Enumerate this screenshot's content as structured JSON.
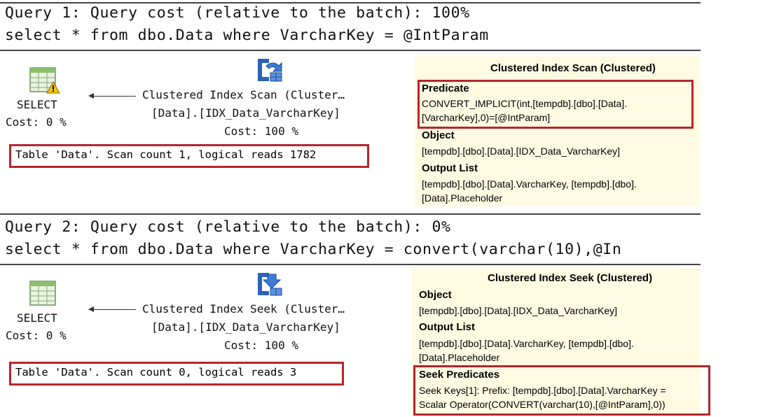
{
  "query1": {
    "header": "Query 1: Query cost (relative to the batch): 100%",
    "sql": "select * from dbo.Data where VarcharKey = @IntParam",
    "select_label": "SELECT",
    "select_cost": "Cost: 0 %",
    "op_name": "Clustered Index Scan (Cluster…",
    "op_object": "[Data].[IDX_Data_VarcharKey]",
    "op_cost": "Cost: 100 %",
    "stats": "Table 'Data'. Scan count 1, logical reads 1782",
    "tooltip": {
      "title": "Clustered Index Scan (Clustered)",
      "predicate_head": "Predicate",
      "predicate_line1": "CONVERT_IMPLICIT(int,[tempdb].[dbo].[Data].",
      "predicate_line2": "[VarcharKey],0)=[@IntParam]",
      "object_head": "Object",
      "object_line": "[tempdb].[dbo].[Data].[IDX_Data_VarcharKey]",
      "output_head": "Output List",
      "output_line1": "[tempdb].[dbo].[Data].VarcharKey, [tempdb].[dbo].",
      "output_line2": "[Data].Placeholder"
    }
  },
  "query2": {
    "header": "Query 2: Query cost (relative to the batch): 0%",
    "sql": "select * from dbo.Data where VarcharKey = convert(varchar(10),@In",
    "select_label": "SELECT",
    "select_cost": "Cost: 0 %",
    "op_name": "Clustered Index Seek (Cluster…",
    "op_object": "[Data].[IDX_Data_VarcharKey]",
    "op_cost": "Cost: 100 %",
    "stats": "Table 'Data'. Scan count 0, logical reads 3",
    "tooltip": {
      "title": "Clustered Index Seek (Clustered)",
      "object_head": "Object",
      "object_line": "[tempdb].[dbo].[Data].[IDX_Data_VarcharKey]",
      "output_head": "Output List",
      "output_line1": "[tempdb].[dbo].[Data].VarcharKey, [tempdb].[dbo].",
      "output_line2": "[Data].Placeholder",
      "seek_head": "Seek Predicates",
      "seek_line1": "Seek Keys[1]: Prefix: [tempdb].[dbo].[Data].VarcharKey =",
      "seek_line2": "Scalar Operator(CONVERT(varchar(10),[@IntParam],0))"
    }
  },
  "icons": {
    "select_icon": "table-grid-icon",
    "warning_icon": "warning-icon",
    "scan_icon": "clustered-index-scan-icon",
    "seek_icon": "clustered-index-seek-icon"
  },
  "colors": {
    "highlight_border": "#b5252b",
    "tooltip_background": "#fffbe3",
    "operator_icon_blue": "#2a63b8"
  }
}
